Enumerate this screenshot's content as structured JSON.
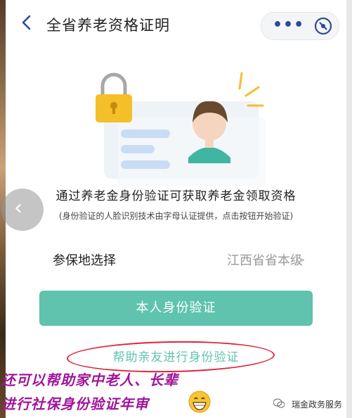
{
  "header": {
    "title": "全省养老资格证明",
    "more_icon": "more-dots-icon",
    "close_icon": "close-target-icon",
    "more_label": "•••"
  },
  "illustration": {
    "icon": "id-card-lock-illustration"
  },
  "intro": {
    "text": "通过养老金身份验证可获取养老金领取资格",
    "subtext": "(身份验证的人脸识别技术由字母认证提供，点击按钮开始验证)"
  },
  "location": {
    "label": "参保地选择",
    "value": "江西省省本级",
    "chevron": ">"
  },
  "actions": {
    "self_verify": "本人身份验证",
    "help_relative": "帮助亲友进行身份验证"
  },
  "annotation": {
    "line1": "还可以帮助家中老人、长辈",
    "line2": "进行社保身份验证年审"
  },
  "watermark": {
    "text": "瑞金政务服务"
  },
  "colors": {
    "accent": "#5fc3ae",
    "nav_icon": "#2d4a9a",
    "annotation": "#a0159a",
    "circle": "#e0243a"
  }
}
